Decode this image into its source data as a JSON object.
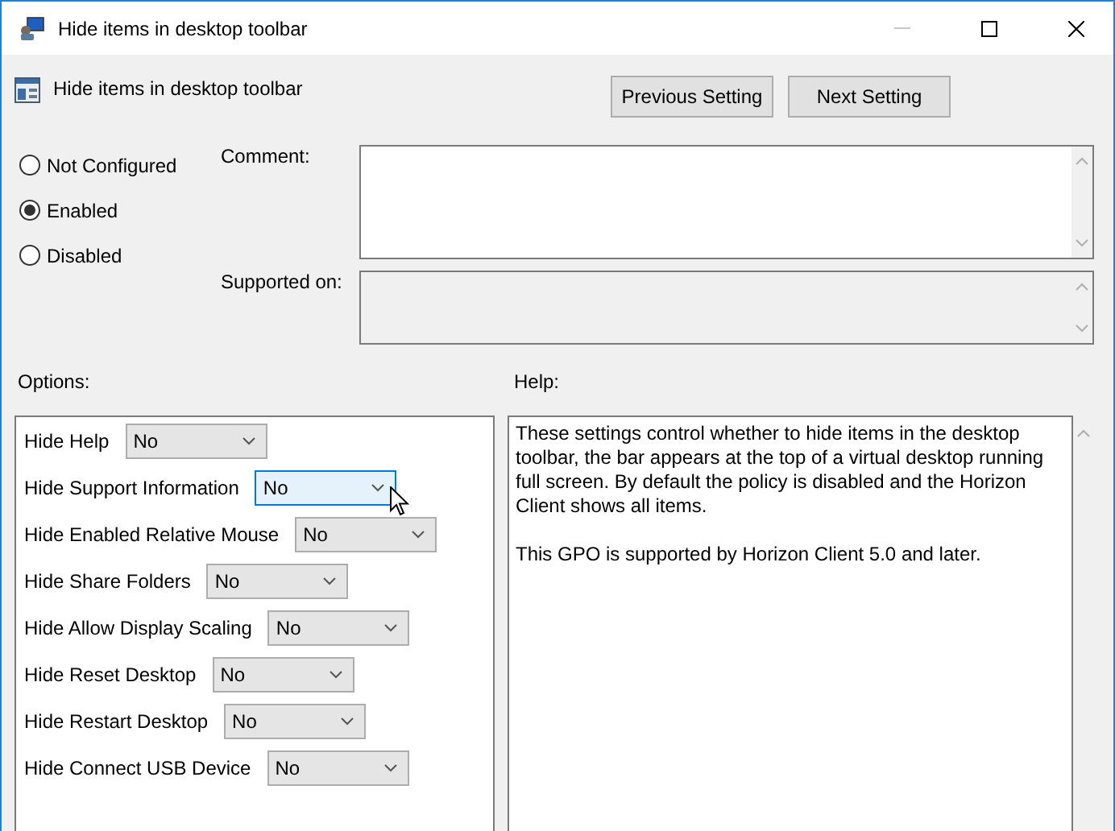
{
  "window": {
    "title": "Hide items in desktop toolbar"
  },
  "policy": {
    "title": "Hide items in desktop toolbar"
  },
  "nav_buttons": [
    "Previous Setting",
    "Next Setting"
  ],
  "states": [
    {
      "label": "Not Configured",
      "selected": false
    },
    {
      "label": "Enabled",
      "selected": true
    },
    {
      "label": "Disabled",
      "selected": false
    }
  ],
  "comment": {
    "label": "Comment:"
  },
  "supported_on": {
    "label": "Supported on:"
  },
  "options": {
    "label": "Options:",
    "items": [
      {
        "label": "Hide Help",
        "value": "No",
        "hovered": false
      },
      {
        "label": "Hide Support Information",
        "value": "No",
        "hovered": true
      },
      {
        "label": "Hide Enabled Relative Mouse",
        "value": "No",
        "hovered": false
      },
      {
        "label": "Hide Share Folders",
        "value": "No",
        "hovered": false
      },
      {
        "label": "Hide Allow Display Scaling",
        "value": "No",
        "hovered": false
      },
      {
        "label": "Hide Reset Desktop",
        "value": "No",
        "hovered": false
      },
      {
        "label": "Hide Restart Desktop",
        "value": "No",
        "hovered": false
      },
      {
        "label": "Hide Connect USB Device",
        "value": "No",
        "hovered": false
      }
    ]
  },
  "help": {
    "label": "Help:",
    "paragraphs": [
      "These settings control whether to hide items in the desktop toolbar, the bar appears at the top of a virtual desktop running full screen. By default the policy is disabled and the Horizon Client shows all items.",
      "This GPO is supported by Horizon Client 5.0 and later."
    ]
  }
}
